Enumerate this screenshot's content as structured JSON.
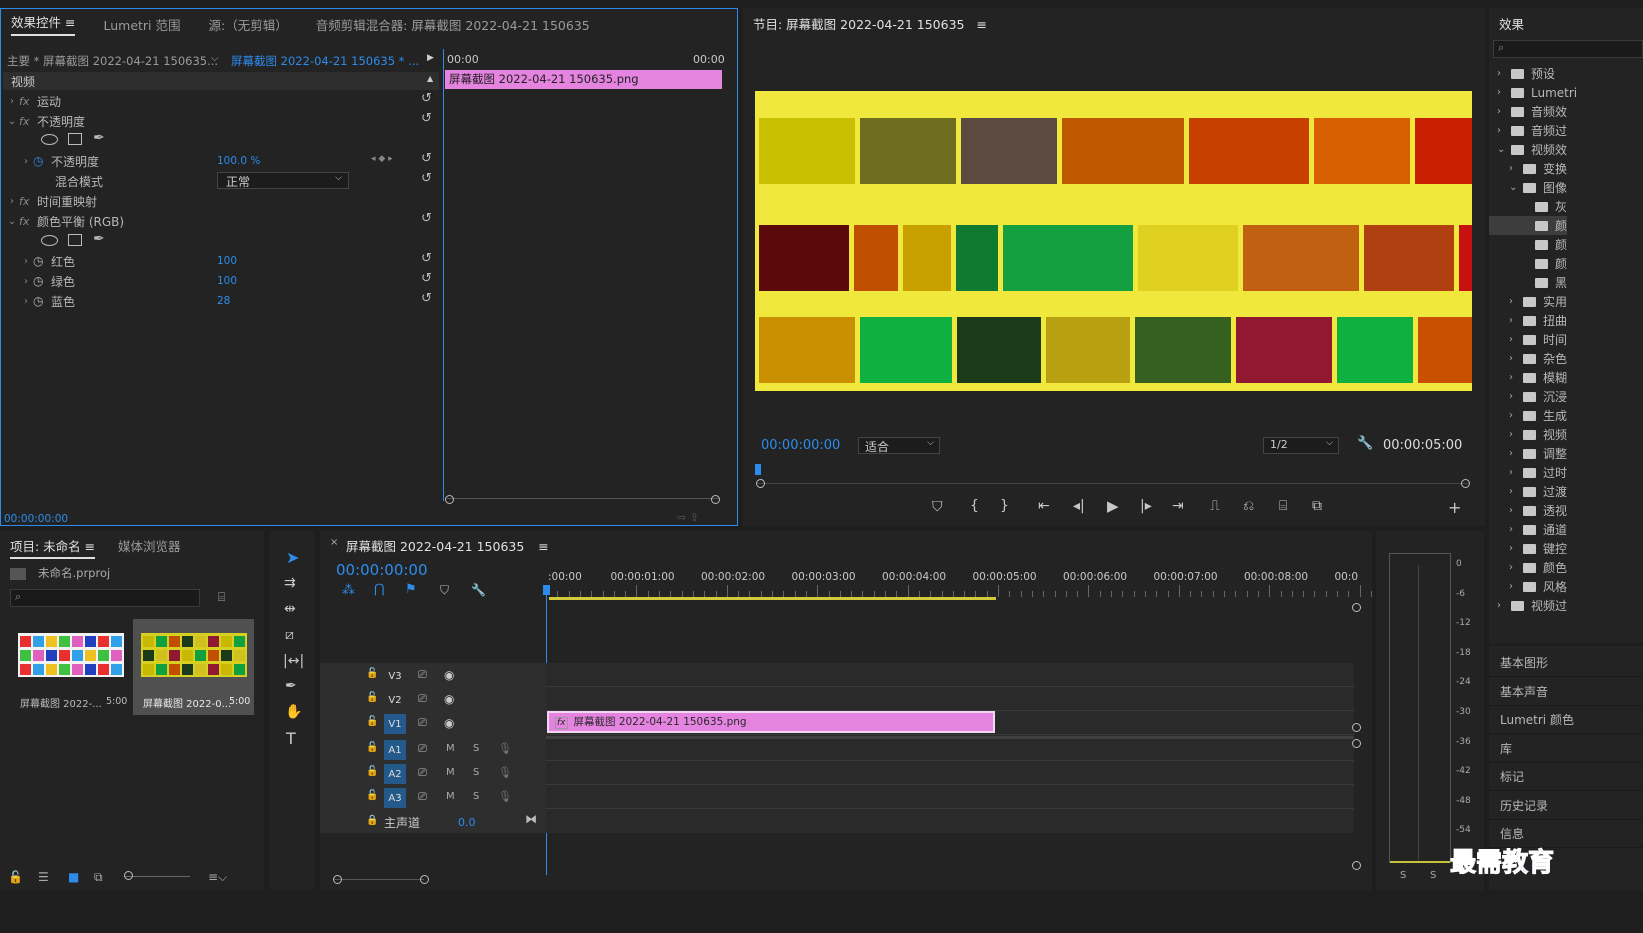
{
  "effect_controls": {
    "tabs": [
      "效果控件",
      "Lumetri 范围",
      "源:（无剪辑）",
      "音频剪辑混合器: 屏幕截图 2022-04-21 150635"
    ],
    "master": "主要 * 屏幕截图 2022-04-21 150635...",
    "clip": "屏幕截图 2022-04-21 150635 * ...",
    "ruler_start": "00:00",
    "ruler_end": "00:00",
    "clip_name": "屏幕截图 2022-04-21  150635.png",
    "section": "视频",
    "motion": "运动",
    "opacity": "不透明度",
    "opacity_param": "不透明度",
    "opacity_value": "100.0 %",
    "blend_mode": "混合模式",
    "blend_value": "正常",
    "time_remap": "时间重映射",
    "color_balance": "颜色平衡 (RGB)",
    "red": "红色",
    "red_value": "100",
    "green": "绿色",
    "green_value": "100",
    "blue": "蓝色",
    "blue_value": "28",
    "timecode": "00:00:00:00"
  },
  "program": {
    "title": "节目: 屏幕截图 2022-04-21 150635",
    "timecode": "00:00:00:00",
    "fit": "适合",
    "quality": "1/2",
    "duration": "00:00:05:00"
  },
  "effects": {
    "title": "效果",
    "items": [
      "预设",
      "Lumetri",
      "音频效",
      "音频过",
      "视频效",
      "变换",
      "图像",
      "灰",
      "颜",
      "颜",
      "颜",
      "黑",
      "实用",
      "扭曲",
      "时间",
      "杂色",
      "模糊",
      "沉浸",
      "生成",
      "视频",
      "调整",
      "过时",
      "过渡",
      "透视",
      "通道",
      "键控",
      "颜色",
      "风格",
      "视频过"
    ]
  },
  "side_panels": [
    "基本图形",
    "基本声音",
    "Lumetri 颜色",
    "库",
    "标记",
    "历史记录",
    "信息"
  ],
  "project": {
    "tabs": [
      "项目: 未命名",
      "媒体浏览器"
    ],
    "file": "未命名.prproj",
    "items": [
      {
        "name": "屏幕截图 2022-...",
        "dur": "5:00"
      },
      {
        "name": "屏幕截图 2022-0...",
        "dur": "5:00"
      }
    ]
  },
  "timeline": {
    "title": "屏幕截图 2022-04-21 150635",
    "timecode": "00:00:00:00",
    "ruler": [
      ":00:00",
      "00:00:01:00",
      "00:00:02:00",
      "00:00:03:00",
      "00:00:04:00",
      "00:00:05:00",
      "00:00:06:00",
      "00:00:07:00",
      "00:00:08:00",
      "00:0"
    ],
    "video_tracks": [
      "V3",
      "V2",
      "V1"
    ],
    "audio_tracks": [
      "A1",
      "A2",
      "A3"
    ],
    "master": "主声道",
    "master_value": "0.0",
    "clip": "屏幕截图 2022-04-21  150635.png",
    "mute": "M",
    "solo": "S"
  },
  "meter": {
    "scale": [
      "0",
      "-6",
      "-12",
      "-18",
      "-24",
      "-30",
      "-36",
      "-42",
      "-48",
      "-54"
    ],
    "buttons": [
      "S",
      "S"
    ]
  },
  "watermark": "最需教育"
}
